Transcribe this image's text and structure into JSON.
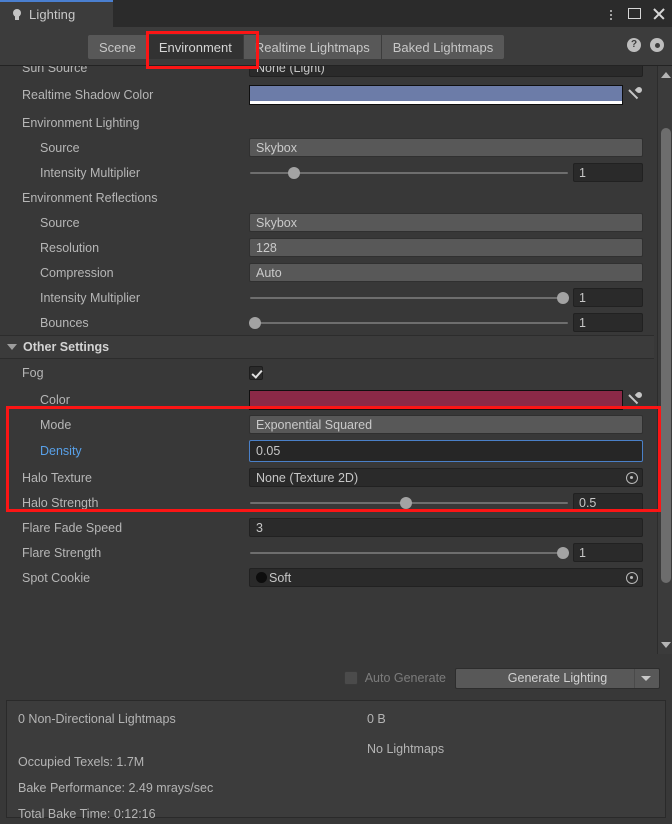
{
  "window": {
    "tab_title": "Lighting",
    "bulb_icon": "lightbulb-icon",
    "controls": {
      "menu": "kebab-menu-icon",
      "maximize": "maximize-icon",
      "close": "close-icon"
    }
  },
  "toolbar": {
    "tabs": [
      {
        "label": "Scene",
        "active": false
      },
      {
        "label": "Environment",
        "active": true
      },
      {
        "label": "Realtime Lightmaps",
        "active": false
      },
      {
        "label": "Baked Lightmaps",
        "active": false
      }
    ],
    "help_icon": "help-icon",
    "help_glyph": "?",
    "settings_icon": "gear-icon"
  },
  "settings": {
    "clipped_top_row": {
      "label": "Sun Source",
      "value": "None (Light)"
    },
    "realtime_shadow_color": {
      "label": "Realtime Shadow Color",
      "color": "#6C7CA8",
      "alpha_bar": "#FFFFFF",
      "eyedropper_icon": "eyedropper-icon"
    },
    "environment_lighting": {
      "header": "Environment Lighting",
      "source": {
        "label": "Source",
        "value": "Skybox"
      },
      "intensity_multiplier": {
        "label": "Intensity Multiplier",
        "value": "1",
        "slider_percent": 14
      }
    },
    "environment_reflections": {
      "header": "Environment Reflections",
      "source": {
        "label": "Source",
        "value": "Skybox"
      },
      "resolution": {
        "label": "Resolution",
        "value": "128"
      },
      "compression": {
        "label": "Compression",
        "value": "Auto"
      },
      "intensity_multiplier": {
        "label": "Intensity Multiplier",
        "value": "1",
        "slider_percent": 98
      },
      "bounces": {
        "label": "Bounces",
        "value": "1",
        "slider_percent": 2
      }
    },
    "other_settings": {
      "header": "Other Settings",
      "foldout_icon": "triangle-down-icon",
      "fog": {
        "label": "Fog",
        "checked": true
      },
      "fog_color": {
        "label": "Color",
        "color": "#8B2947",
        "alpha_bar": "#FFFFFF",
        "eyedropper_icon": "eyedropper-icon"
      },
      "fog_mode": {
        "label": "Mode",
        "value": "Exponential Squared"
      },
      "fog_density": {
        "label": "Density",
        "value": "0.05",
        "focused": true
      },
      "halo_texture": {
        "label": "Halo Texture",
        "value": "None (Texture 2D)",
        "picker_icon": "object-picker-icon"
      },
      "halo_strength": {
        "label": "Halo Strength",
        "value": "0.5",
        "slider_percent": 49
      },
      "flare_fade_speed": {
        "label": "Flare Fade Speed",
        "value": "3"
      },
      "flare_strength": {
        "label": "Flare Strength",
        "value": "1",
        "slider_percent": 98
      },
      "spot_cookie": {
        "label": "Spot Cookie",
        "value": "Soft",
        "swatch_color": "#0D0D0D",
        "picker_icon": "object-picker-icon"
      }
    }
  },
  "generate": {
    "auto_generate_label": "Auto Generate",
    "auto_generate_checked": false,
    "button_label": "Generate Lighting",
    "dropdown_icon": "caret-down-icon"
  },
  "stats": {
    "lightmaps_count": "0 Non-Directional Lightmaps",
    "size": "0 B",
    "no_lightmaps": "No Lightmaps",
    "occupied_texels": "Occupied Texels: 1.7M",
    "bake_performance": "Bake Performance: 2.49 mrays/sec",
    "total_bake_time": "Total Bake Time: 0:12:16"
  },
  "annotations": {
    "highlight_color": "#FB1515",
    "boxes": [
      "environment-tab",
      "fog-settings-group"
    ]
  }
}
